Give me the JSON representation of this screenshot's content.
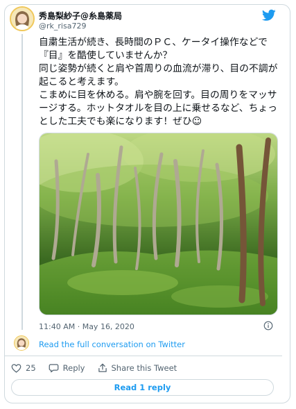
{
  "author": {
    "name": "秀島梨紗子@糸島薬局",
    "handle": "@rk_risa729"
  },
  "tweet": {
    "paragraphs": [
      "自粛生活が続き、長時間のＰＣ、ケータイ操作などで『目』を酷使していませんか？",
      "同じ姿勢が続くと肩や首周りの血流が滞り、目の不調が起こると考えます。",
      "こまめに目を休める。肩や腕を回す。目の周りをマッサージする。ホットタオルを目の上に乗せるなど、ちょっとした工夫でも楽になります！ぜひ☺"
    ],
    "timestamp": "11:40 AM · May 16, 2020"
  },
  "conversation": {
    "link_label": "Read the full conversation on Twitter"
  },
  "actions": {
    "like_count": "25",
    "reply_label": "Reply",
    "share_label": "Share this Tweet"
  },
  "read_reply_label": "Read 1 reply",
  "colors": {
    "accent": "#1d9bf0",
    "border": "#cfd9de",
    "secondary_text": "#536471"
  },
  "icons": {
    "brand": "twitter-bird-icon",
    "info": "info-icon",
    "like": "heart-icon",
    "reply": "reply-icon",
    "share": "share-icon"
  }
}
